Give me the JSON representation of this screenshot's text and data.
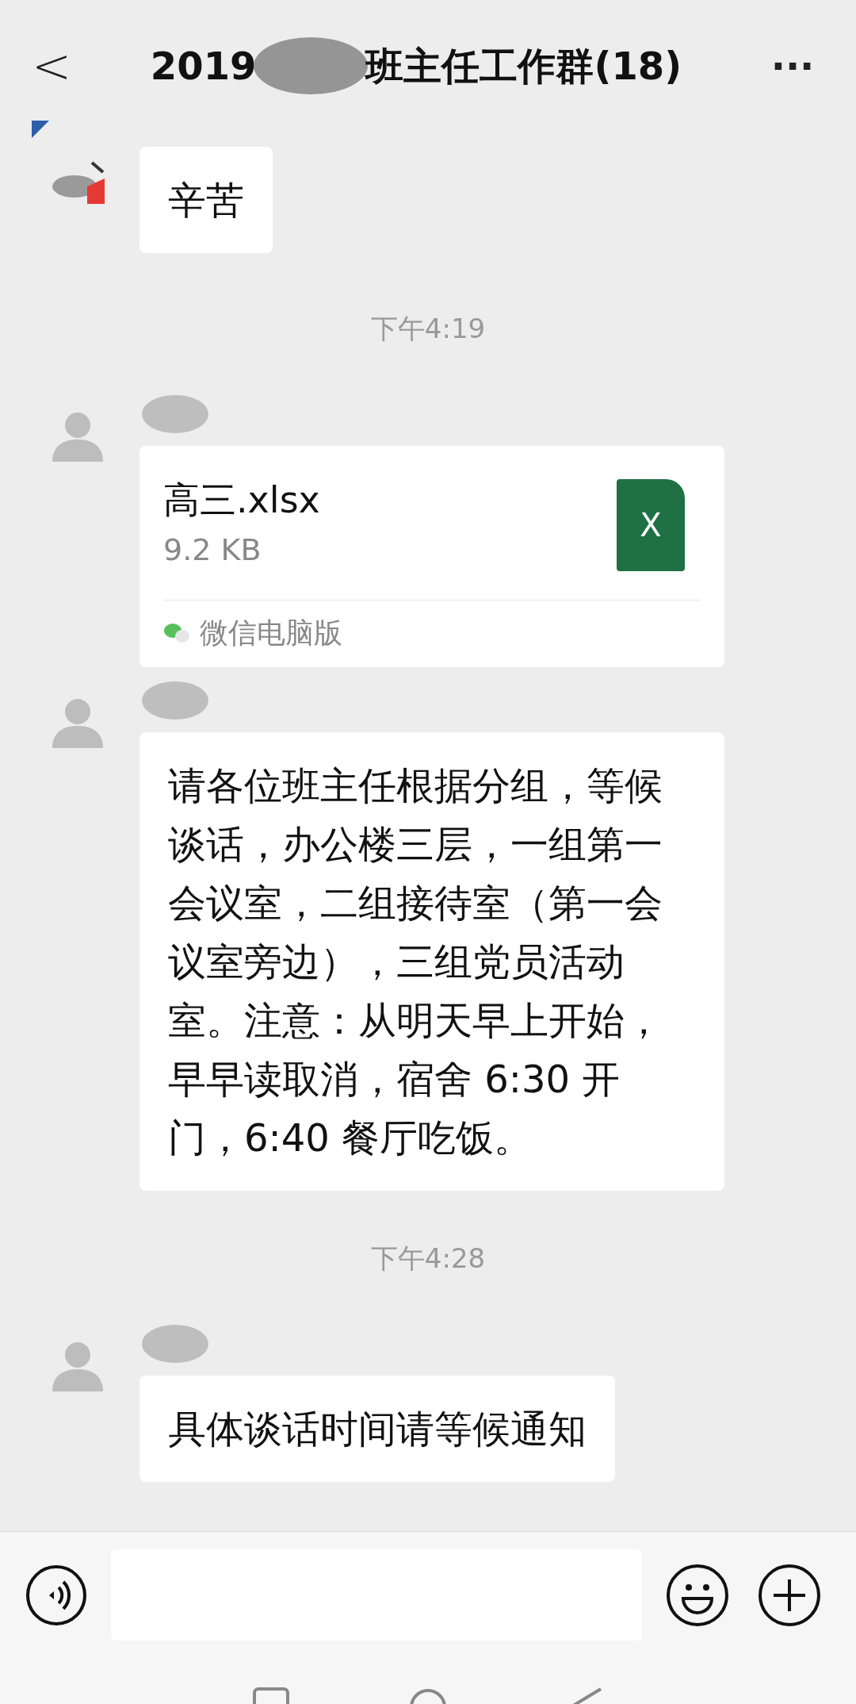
{
  "header": {
    "back": "<",
    "title_start": "2019",
    "title_end": "班主任工作群(18)",
    "more": "···"
  },
  "messages": [
    {
      "kind": "text",
      "text": "辛苦"
    },
    {
      "kind": "time",
      "text": "下午4:19"
    },
    {
      "kind": "file",
      "avatar": {
        "kind": "default"
      },
      "file_name": "高三.xlsx",
      "file_size": "9.2 KB",
      "file_badge": "X",
      "source": "微信电脑版"
    },
    {
      "kind": "text",
      "avatar": {
        "kind": "default"
      },
      "text": "请各位班主任根据分组，等候谈话，办公楼三层，一组第一会议室，二组接待室（第一会议室旁边），三组党员活动室。注意：从明天早上开始，早早读取消，宿舍 6:30 开门，6:40 餐厅吃饭。"
    },
    {
      "kind": "time",
      "text": "下午4:28"
    },
    {
      "kind": "text",
      "avatar": {
        "kind": "default"
      },
      "text": "具体谈话时间请等候通知"
    }
  ]
}
